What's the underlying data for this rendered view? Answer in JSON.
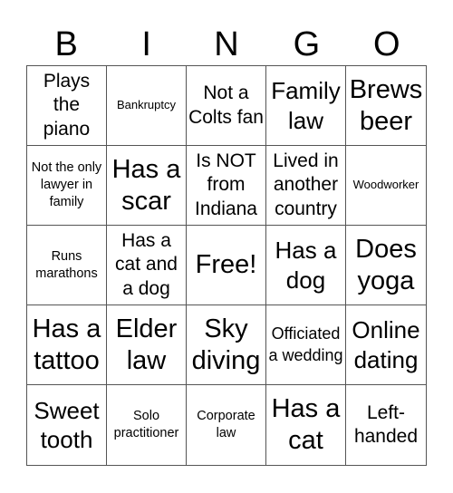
{
  "header": {
    "letters": [
      "B",
      "I",
      "N",
      "G",
      "O"
    ]
  },
  "cells": [
    "Plays the piano",
    "Bankruptcy",
    "Not a Colts fan",
    "Family law",
    "Brews beer",
    "Not the only lawyer in family",
    "Has a scar",
    "Is NOT from Indiana",
    "Lived in another country",
    "Woodworker",
    "Runs marathons",
    "Has a cat and a dog",
    "Free!",
    "Has a dog",
    "Does yoga",
    "Has a tattoo",
    "Elder law",
    "Sky diving",
    "Officiated a wedding",
    "Online dating",
    "Sweet tooth",
    "Solo practitioner",
    "Corporate law",
    "Has a cat",
    "Left-handed"
  ]
}
